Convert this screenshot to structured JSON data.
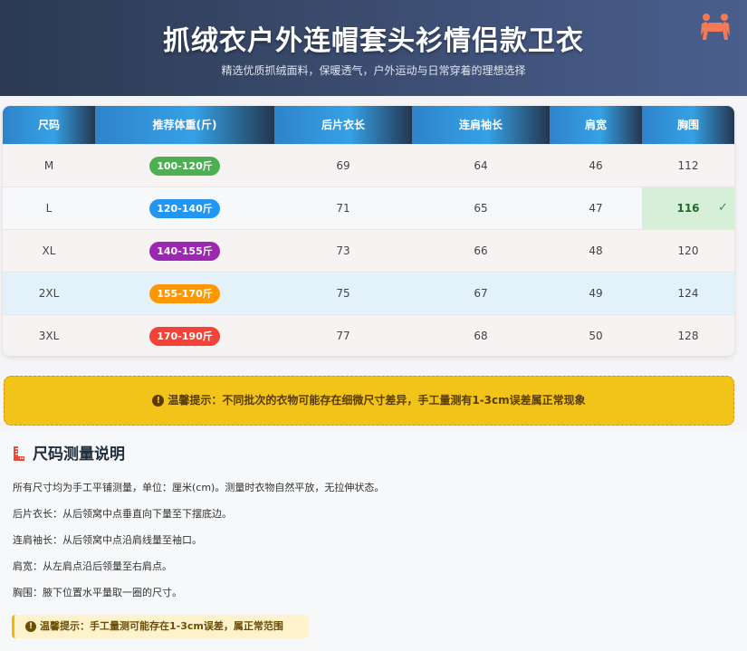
{
  "header": {
    "title": "抓绒衣户外连帽套头衫情侣款卫衣",
    "subtitle": "精选优质抓绒面料，保暖透气，户外运动与日常穿着的理想选择",
    "logo_icon": "people-carry-icon"
  },
  "table": {
    "columns": [
      "尺码",
      "推荐体重(斤)",
      "后片衣长",
      "连肩袖长",
      "肩宽",
      "胸围"
    ],
    "rows": [
      {
        "size": "M",
        "weight": "100-120斤",
        "weight_color": "#4caf50",
        "back_length": "69",
        "sleeve": "64",
        "shoulder": "46",
        "chest": "112",
        "row_bg": "#f8f3f3"
      },
      {
        "size": "L",
        "weight": "120-140斤",
        "weight_color": "#2196f3",
        "back_length": "71",
        "sleeve": "65",
        "shoulder": "47",
        "chest": "116",
        "row_bg": "#f6f8fa",
        "highlight": true,
        "check": "✓"
      },
      {
        "size": "XL",
        "weight": "140-155斤",
        "weight_color": "#9c27b0",
        "back_length": "73",
        "sleeve": "66",
        "shoulder": "48",
        "chest": "120",
        "row_bg": "#f8f3f3"
      },
      {
        "size": "2XL",
        "weight": "155-170斤",
        "weight_color": "#ff9800",
        "back_length": "75",
        "sleeve": "67",
        "shoulder": "49",
        "chest": "124",
        "row_bg": "#e3f1fb"
      },
      {
        "size": "3XL",
        "weight": "170-190斤",
        "weight_color": "#f44336",
        "back_length": "77",
        "sleeve": "68",
        "shoulder": "50",
        "chest": "128",
        "row_bg": "#f8f3f3"
      }
    ]
  },
  "notice": {
    "icon": "info-icon",
    "text": "温馨提示：不同批次的衣物可能存在细微尺寸差异，手工量测有1-3cm误差属正常现象"
  },
  "guide": {
    "title_icon": "ruler-icon",
    "title": "尺码测量说明",
    "paragraphs": [
      "所有尺寸均为手工平铺测量，单位：厘米(cm)。测量时衣物自然平放，无拉伸状态。",
      "后片衣长：从后领窝中点垂直向下量至下摆底边。",
      "连肩袖长：从后领窝中点沿肩线量至袖口。",
      "肩宽：从左肩点沿后领量至右肩点。",
      "胸围：腋下位置水平量取一圈的尺寸。"
    ],
    "tip_icon": "info-icon",
    "tip": "温馨提示：手工量测可能存在1-3cm误差，属正常范围"
  },
  "colors": {
    "header_bg": "#2b3a52",
    "table_head": "#35a1e6",
    "highlight_bg": "#d5efd8",
    "notice_bg": "#f2c318",
    "tip_bg": "#fff3cd"
  }
}
